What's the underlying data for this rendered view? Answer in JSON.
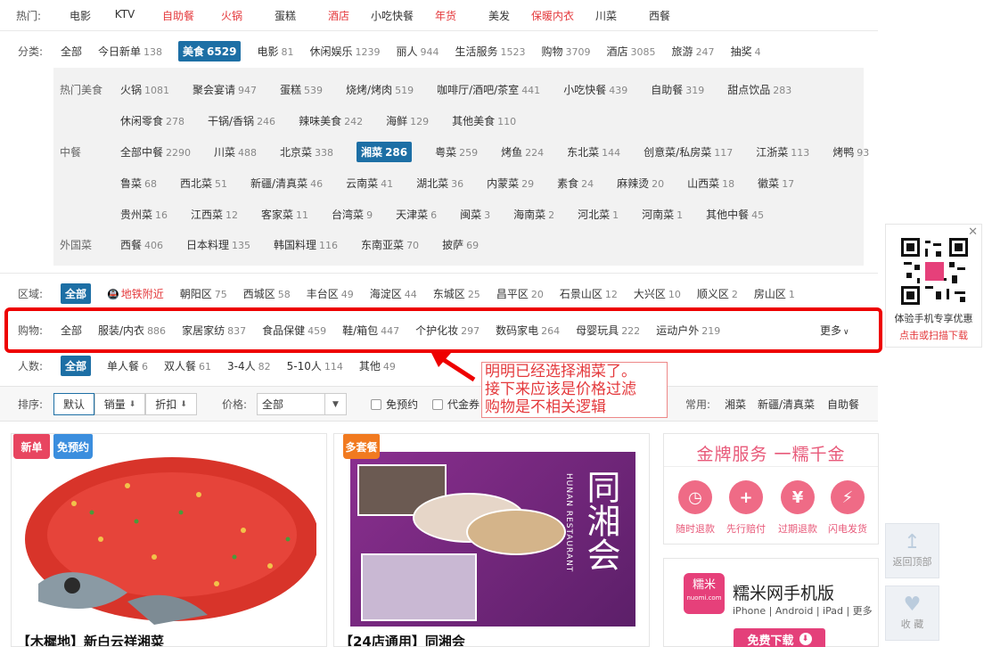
{
  "hot": {
    "label": "热门:",
    "items": [
      {
        "text": "电影",
        "red": false
      },
      {
        "text": "KTV",
        "red": false
      },
      {
        "text": "自助餐",
        "red": true
      },
      {
        "text": "火锅",
        "red": true
      },
      {
        "text": "蛋糕",
        "red": false
      },
      {
        "text": "酒店",
        "red": true
      },
      {
        "text": "小吃快餐",
        "red": false
      },
      {
        "text": "年货",
        "red": true
      },
      {
        "text": "美发",
        "red": false
      },
      {
        "text": "保暖内衣",
        "red": true
      },
      {
        "text": "川菜",
        "red": false
      },
      {
        "text": "西餐",
        "red": false
      }
    ]
  },
  "category": {
    "label": "分类:",
    "items": [
      {
        "text": "全部",
        "count": ""
      },
      {
        "text": "今日新单",
        "count": "138"
      },
      {
        "text": "美食",
        "count": "6529",
        "selected": true
      },
      {
        "text": "电影",
        "count": "81"
      },
      {
        "text": "休闲娱乐",
        "count": "1239"
      },
      {
        "text": "丽人",
        "count": "944"
      },
      {
        "text": "生活服务",
        "count": "1523"
      },
      {
        "text": "购物",
        "count": "3709"
      },
      {
        "text": "酒店",
        "count": "3085"
      },
      {
        "text": "旅游",
        "count": "247"
      },
      {
        "text": "抽奖",
        "count": "4"
      }
    ]
  },
  "sub": {
    "rows": [
      {
        "label": "热门美食",
        "items": [
          {
            "text": "火锅",
            "count": "1081"
          },
          {
            "text": "聚会宴请",
            "count": "947"
          },
          {
            "text": "蛋糕",
            "count": "539"
          },
          {
            "text": "烧烤/烤肉",
            "count": "519"
          },
          {
            "text": "咖啡厅/酒吧/茶室",
            "count": "441"
          },
          {
            "text": "小吃快餐",
            "count": "439"
          },
          {
            "text": "自助餐",
            "count": "319"
          },
          {
            "text": "甜点饮品",
            "count": "283"
          }
        ]
      },
      {
        "label": "",
        "items": [
          {
            "text": "休闲零食",
            "count": "278"
          },
          {
            "text": "干锅/香锅",
            "count": "246"
          },
          {
            "text": "辣味美食",
            "count": "242"
          },
          {
            "text": "海鲜",
            "count": "129"
          },
          {
            "text": "其他美食",
            "count": "110"
          }
        ]
      },
      {
        "label": "中餐",
        "items": [
          {
            "text": "全部中餐",
            "count": "2290"
          },
          {
            "text": "川菜",
            "count": "488"
          },
          {
            "text": "北京菜",
            "count": "338"
          },
          {
            "text": "湘菜",
            "count": "286",
            "selected": true
          },
          {
            "text": "粤菜",
            "count": "259"
          },
          {
            "text": "烤鱼",
            "count": "224"
          },
          {
            "text": "东北菜",
            "count": "144"
          },
          {
            "text": "创意菜/私房菜",
            "count": "117"
          },
          {
            "text": "江浙菜",
            "count": "113"
          },
          {
            "text": "烤鸭",
            "count": "93"
          }
        ]
      },
      {
        "label": "",
        "items": [
          {
            "text": "鲁菜",
            "count": "68"
          },
          {
            "text": "西北菜",
            "count": "51"
          },
          {
            "text": "新疆/清真菜",
            "count": "46"
          },
          {
            "text": "云南菜",
            "count": "41"
          },
          {
            "text": "湖北菜",
            "count": "36"
          },
          {
            "text": "内蒙菜",
            "count": "29"
          },
          {
            "text": "素食",
            "count": "24"
          },
          {
            "text": "麻辣烫",
            "count": "20"
          },
          {
            "text": "山西菜",
            "count": "18"
          },
          {
            "text": "徽菜",
            "count": "17"
          }
        ]
      },
      {
        "label": "",
        "items": [
          {
            "text": "贵州菜",
            "count": "16"
          },
          {
            "text": "江西菜",
            "count": "12"
          },
          {
            "text": "客家菜",
            "count": "11"
          },
          {
            "text": "台湾菜",
            "count": "9"
          },
          {
            "text": "天津菜",
            "count": "6"
          },
          {
            "text": "闽菜",
            "count": "3"
          },
          {
            "text": "海南菜",
            "count": "2"
          },
          {
            "text": "河北菜",
            "count": "1"
          },
          {
            "text": "河南菜",
            "count": "1"
          },
          {
            "text": "其他中餐",
            "count": "45"
          }
        ]
      },
      {
        "label": "外国菜",
        "items": [
          {
            "text": "西餐",
            "count": "406"
          },
          {
            "text": "日本料理",
            "count": "135"
          },
          {
            "text": "韩国料理",
            "count": "116"
          },
          {
            "text": "东南亚菜",
            "count": "70"
          },
          {
            "text": "披萨",
            "count": "69"
          }
        ]
      }
    ]
  },
  "area": {
    "label": "区域:",
    "items": [
      {
        "text": "全部",
        "count": "",
        "selected": true
      },
      {
        "text": "地铁附近",
        "count": "",
        "red": true
      },
      {
        "text": "朝阳区",
        "count": "75"
      },
      {
        "text": "西城区",
        "count": "58"
      },
      {
        "text": "丰台区",
        "count": "49"
      },
      {
        "text": "海淀区",
        "count": "44"
      },
      {
        "text": "东城区",
        "count": "25"
      },
      {
        "text": "昌平区",
        "count": "20"
      },
      {
        "text": "石景山区",
        "count": "12"
      },
      {
        "text": "大兴区",
        "count": "10"
      },
      {
        "text": "顺义区",
        "count": "2"
      },
      {
        "text": "房山区",
        "count": "1"
      }
    ]
  },
  "shopping": {
    "label": "购物:",
    "items": [
      {
        "text": "全部",
        "count": ""
      },
      {
        "text": "服装/内衣",
        "count": "886"
      },
      {
        "text": "家居家纺",
        "count": "837"
      },
      {
        "text": "食品保健",
        "count": "459"
      },
      {
        "text": "鞋/箱包",
        "count": "447"
      },
      {
        "text": "个护化妆",
        "count": "297"
      },
      {
        "text": "数码家电",
        "count": "264"
      },
      {
        "text": "母婴玩具",
        "count": "222"
      },
      {
        "text": "运动户外",
        "count": "219"
      }
    ],
    "more": "更多"
  },
  "people": {
    "label": "人数:",
    "items": [
      {
        "text": "全部",
        "count": "",
        "selected": true
      },
      {
        "text": "单人餐",
        "count": "6"
      },
      {
        "text": "双人餐",
        "count": "61"
      },
      {
        "text": "3-4人",
        "count": "82"
      },
      {
        "text": "5-10人",
        "count": "114"
      },
      {
        "text": "其他",
        "count": "49"
      }
    ]
  },
  "sort": {
    "label": "排序:",
    "default": "默认",
    "sales": "销量",
    "discount": "折扣",
    "price_label": "价格:",
    "price_value": "全部",
    "no_reservation": "免预约",
    "voucher": "代金券",
    "common_label": "常用:",
    "common": [
      "湘菜",
      "新疆/清真菜",
      "自助餐"
    ]
  },
  "annotation": {
    "lines": [
      "明明已经选择湘菜了。",
      "接下来应该是价格过滤",
      "购物是不相关逻辑"
    ]
  },
  "deals": [
    {
      "title": "【木樨地】新白云祥湘菜",
      "tags": [
        "新单",
        "免预约"
      ]
    },
    {
      "title": "【24店通用】同湘会",
      "tags": [
        "多套餐"
      ],
      "brand": "同湘会",
      "brand_en": "HUNAN RESTAURANT"
    }
  ],
  "gold": {
    "title": "金牌服务 一糯千金",
    "items": [
      "随时退款",
      "先行赔付",
      "过期退款",
      "闪电发货"
    ]
  },
  "app": {
    "logo": "糯米",
    "logo_sub": "nuomi.com",
    "name": "糯米网手机版",
    "platforms": "iPhone | Android | iPad | 更多",
    "download": "免费下载"
  },
  "qr": {
    "line1": "体验手机专享优惠",
    "line2": "点击或扫描下载"
  },
  "side": {
    "top": "返回顶部",
    "fav": "收 藏"
  },
  "colors": {
    "accent": "#1d6fa5",
    "red": "#e4393c",
    "pink": "#e85a7a"
  }
}
